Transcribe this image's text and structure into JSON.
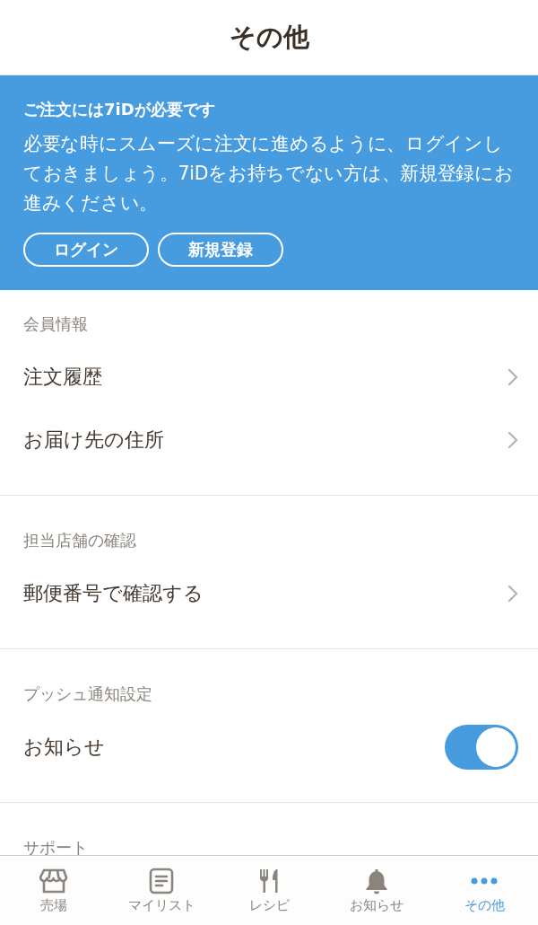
{
  "header": {
    "title": "その他"
  },
  "notice": {
    "title": "ご注文には7iDが必要です",
    "body": "必要な時にスムーズに注文に進めるように、ログインしておきましょう。7iDをお持ちでない方は、新規登録にお進みください。",
    "buttons": [
      "ログイン",
      "新規登録"
    ]
  },
  "sections": [
    {
      "heading": "会員情報",
      "items": [
        {
          "kind": "link",
          "label": "注文履歴"
        },
        {
          "kind": "link",
          "label": "お届け先の住所"
        }
      ]
    },
    {
      "heading": "担当店舗の確認",
      "items": [
        {
          "kind": "link",
          "label": "郵便番号で確認する"
        }
      ]
    },
    {
      "heading": "プッシュ通知設定",
      "items": [
        {
          "kind": "toggle",
          "label": "お知らせ",
          "on": true
        }
      ]
    },
    {
      "heading": "サポート"
    }
  ],
  "tab_bar": [
    {
      "kind": "store",
      "label": "売場",
      "selected": false
    },
    {
      "kind": "list",
      "label": "マイリスト",
      "selected": false
    },
    {
      "kind": "cutlery",
      "label": "レシピ",
      "selected": false
    },
    {
      "kind": "bell",
      "label": "お知らせ",
      "selected": false
    },
    {
      "kind": "more",
      "label": "その他",
      "selected": true
    }
  ]
}
